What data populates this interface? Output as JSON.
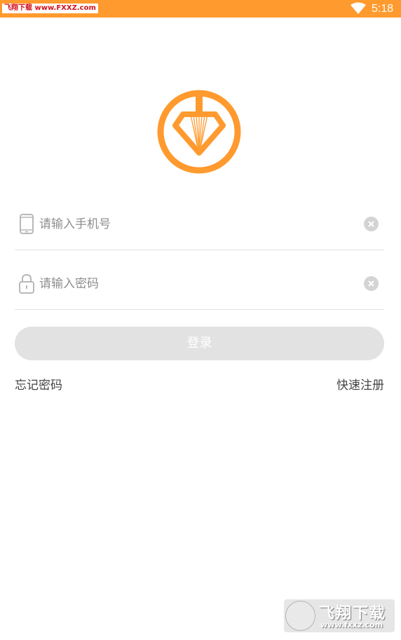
{
  "status_bar": {
    "badge_text": "飞翔下载 www.FXXZ.com",
    "time": "5:18",
    "background_color": "#ff9a2e"
  },
  "logo": {
    "icon": "diamond-in-circle-logo",
    "color": "#ff9a2e"
  },
  "login_form": {
    "phone": {
      "placeholder": "请输入手机号",
      "value": "",
      "icon": "phone-icon"
    },
    "password": {
      "placeholder": "请输入密码",
      "value": "",
      "icon": "lock-icon"
    },
    "clear_icon": "clear-icon",
    "login_label": "登录"
  },
  "links": {
    "forgot_password": "忘记密码",
    "quick_register": "快速注册"
  },
  "watermark": {
    "title": "飞翔下载",
    "url": "www.fxxz.com"
  }
}
